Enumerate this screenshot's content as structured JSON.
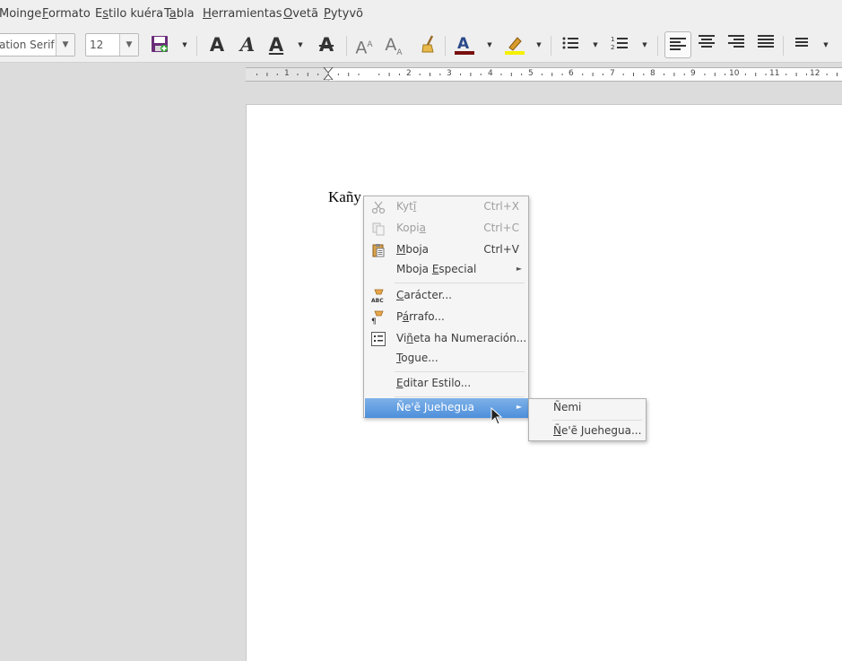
{
  "menubar": {
    "items": [
      {
        "pre": "Moinge",
        "ul": "",
        "post": ""
      },
      {
        "pre": "",
        "ul": "F",
        "post": "ormato"
      },
      {
        "pre": "E",
        "ul": "s",
        "post": "tilo kuéra"
      },
      {
        "pre": "T",
        "ul": "a",
        "post": "bla"
      },
      {
        "pre": "",
        "ul": "H",
        "post": "erramientas"
      },
      {
        "pre": "",
        "ul": "O",
        "post": "vetã"
      },
      {
        "pre": "",
        "ul": "P",
        "post": "ytyvõ"
      }
    ]
  },
  "toolbar": {
    "font_name": "ation Serif",
    "font_size": "12",
    "font_color": "#7a1010",
    "highlight_color": "#f5f000",
    "icons": [
      "save-icon",
      "bold-icon",
      "italic-icon",
      "underline-icon",
      "strikethrough-icon",
      "superscript-icon",
      "subscript-icon",
      "clone-formatting-icon",
      "font-color-icon",
      "highlight-icon",
      "unordered-list-icon",
      "ordered-list-icon",
      "align-left-icon",
      "align-center-icon",
      "align-right-icon",
      "justify-icon",
      "line-spacing-icon"
    ]
  },
  "ruler": {
    "numbers": [
      "1",
      "1",
      "2",
      "3",
      "4",
      "5",
      "6",
      "7",
      "8",
      "9",
      "10",
      "11",
      "12"
    ]
  },
  "document": {
    "text": "Kañy"
  },
  "context_menu": {
    "cut": {
      "pre": "Kyt",
      "ul": "ĩ",
      "post": "",
      "shortcut": "Ctrl+X"
    },
    "copy": {
      "pre": "Kopi",
      "ul": "a",
      "post": "",
      "shortcut": "Ctrl+C"
    },
    "paste": {
      "pre": "",
      "ul": "M",
      "post": "boja",
      "shortcut": "Ctrl+V"
    },
    "paste_special": {
      "pre": "Mboja ",
      "ul": "E",
      "post": "special"
    },
    "character": {
      "pre": "",
      "ul": "C",
      "post": "arácter..."
    },
    "paragraph": {
      "pre": "P",
      "ul": "á",
      "post": "rrafo..."
    },
    "bullets": {
      "pre": "Vi",
      "ul": "ñ",
      "post": "eta ha Numeración..."
    },
    "touch": {
      "pre": "",
      "ul": "T",
      "post": "ogue..."
    },
    "edit_style": {
      "pre": "",
      "ul": "E",
      "post": "ditar Estilo..."
    },
    "new_style": {
      "pre": "Ñe'ẽ Juehegua",
      "ul": "",
      "post": ""
    }
  },
  "submenu": {
    "none": {
      "label": "Ñemi"
    },
    "more": {
      "pre": "",
      "ul": "Ñ",
      "post": "e'ẽ Juehegua..."
    }
  }
}
